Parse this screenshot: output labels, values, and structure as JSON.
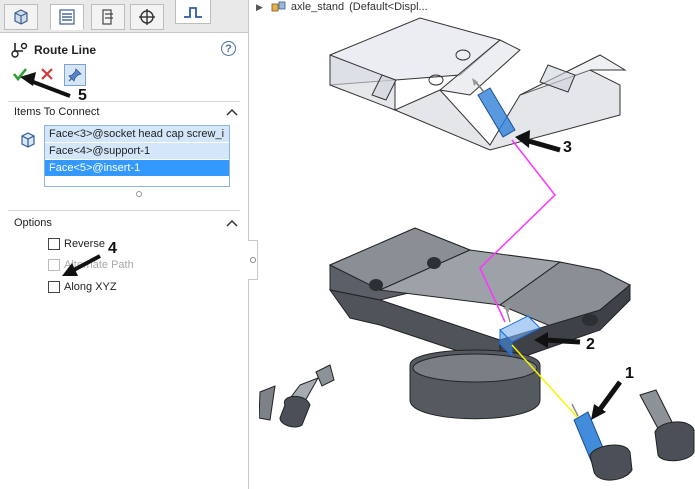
{
  "tabs": [
    {
      "name": "feature-manager",
      "icon": "feature-tree-icon"
    },
    {
      "name": "property-manager",
      "icon": "property-manager-icon"
    },
    {
      "name": "configuration-manager",
      "icon": "configuration-icon"
    },
    {
      "name": "dimxpert",
      "icon": "crosshair-icon"
    }
  ],
  "property_manager": {
    "title": "Route Line",
    "help": "?"
  },
  "items_to_connect": {
    "header": "Items To Connect",
    "items": [
      "Face<3>@socket head cap screw_i",
      "Face<4>@support-1",
      "Face<5>@insert-1"
    ],
    "selected_index": 2
  },
  "options": {
    "header": "Options",
    "reverse": "Reverse",
    "alternate_path": "Alternate Path",
    "along_xyz": "Along XYZ"
  },
  "tree": {
    "model": "axle_stand",
    "config": "(Default<Displ..."
  },
  "callouts": [
    "1",
    "2",
    "3",
    "4",
    "5"
  ],
  "colors": {
    "route_line_magenta": "#ff33ff",
    "route_line_yellow": "#f5f500",
    "selection_blue": "#3399ff",
    "ok_green": "#2e9e2e",
    "cancel_red": "#d43c3c"
  }
}
